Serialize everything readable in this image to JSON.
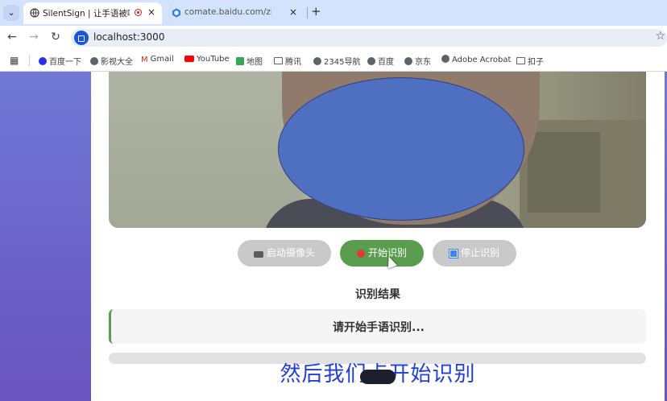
{
  "browser": {
    "tabs": [
      {
        "title": "SilentSign | 让手语被听见",
        "active": true,
        "recording": true
      },
      {
        "title": "comate.baidu.com/zh/activit",
        "active": false
      }
    ],
    "new_tab_symbol": "+",
    "close_symbol": "×",
    "url": "localhost:3000",
    "bookmarks": [
      {
        "label": "百度一下",
        "icon": "paw-icon"
      },
      {
        "label": "影视大全",
        "icon": "globe-icon"
      },
      {
        "label": "Gmail",
        "icon": "gmail-icon"
      },
      {
        "label": "YouTube",
        "icon": "youtube-icon"
      },
      {
        "label": "地图",
        "icon": "maps-icon"
      },
      {
        "label": "腾讯",
        "icon": "folder-icon"
      },
      {
        "label": "2345导航",
        "icon": "globe-icon"
      },
      {
        "label": "百度",
        "icon": "globe-icon"
      },
      {
        "label": "京东",
        "icon": "globe-icon"
      },
      {
        "label": "Adobe Acrobat",
        "icon": "globe-icon"
      },
      {
        "label": "扣子",
        "icon": "folder-icon"
      }
    ]
  },
  "app": {
    "buttons": {
      "start_camera": "启动摄像头",
      "start_recognition": "开始识别",
      "stop_recognition": "停止识别"
    },
    "result_title": "识别结果",
    "result_text": "请开始手语识别...",
    "progress": 0,
    "caption": "然后我们点开始识别"
  },
  "colors": {
    "accent_green": "#5a9d4e",
    "caption_blue": "#1f3fd8",
    "mask_blue": "#4f6fc0"
  }
}
